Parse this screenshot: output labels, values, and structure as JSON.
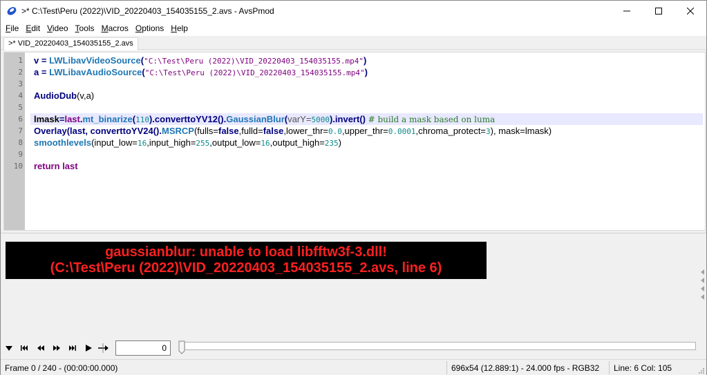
{
  "window": {
    "title": ">* C:\\Test\\Peru (2022)\\VID_20220403_154035155_2.avs - AvsPmod"
  },
  "menu": {
    "items": [
      {
        "label": "File",
        "mnemonic": "F",
        "rest": "ile"
      },
      {
        "label": "Edit",
        "mnemonic": "E",
        "rest": "dit"
      },
      {
        "label": "Video",
        "mnemonic": "V",
        "rest": "ideo"
      },
      {
        "label": "Tools",
        "mnemonic": "T",
        "rest": "ools"
      },
      {
        "label": "Macros",
        "mnemonic": "M",
        "rest": "acros"
      },
      {
        "label": "Options",
        "mnemonic": "O",
        "rest": "ptions"
      },
      {
        "label": "Help",
        "mnemonic": "H",
        "rest": "elp"
      }
    ]
  },
  "tabs": [
    {
      "label": ">* VID_20220403_154035155_2.avs"
    }
  ],
  "editor": {
    "line_numbers": [
      "1",
      "2",
      "3",
      "4",
      "5",
      "6",
      "7",
      "8",
      "9",
      "10"
    ],
    "lines": {
      "l1": {
        "a": "v",
        "b": " = ",
        "c": "LWLibavVideoSource",
        "d": "(",
        "e": "\"C:\\Test\\Peru (2022)\\VID_20220403_154035155.mp4\"",
        "f": ")"
      },
      "l2": {
        "a": "a",
        "b": " = ",
        "c": "LWLibavAudioSource",
        "d": "(",
        "e": "\"C:\\Test\\Peru (2022)\\VID_20220403_154035155.mp4\"",
        "f": ")"
      },
      "l4": {
        "a": "AudioDub",
        "b": "(v,a)"
      },
      "l6": {
        "a": "lmask",
        "b": "=",
        "c": "last",
        "d": ".",
        "e": "mt_binarize",
        "f": "(",
        "g": "110",
        "h": ").",
        "i": "converttoYV12",
        "j": "().",
        "k": "GaussianBlur",
        "l": "(",
        "m": "varY",
        "n": "=",
        "o": "5000",
        "p": ").",
        "q": "invert",
        "r": "() ",
        "s": "# build a mask based on luma"
      },
      "l7": {
        "a": "Overlay",
        "b": "(last, ",
        "c": "converttoYV24",
        "d": "().",
        "e": "MSRCP",
        "f": "(fulls=",
        "g": "false",
        "h": ",fulld=",
        "i": "false",
        "j": ",lower_thr=",
        "k": "0.0",
        "l": ",upper_thr=",
        "m": "0.0001",
        "n": ",chroma_protect=",
        "o": "3",
        "p": "), mask=lmask)"
      },
      "l8": {
        "a": "smoothlevels",
        "b": "(input_low=",
        "c": "16",
        "d": ",input_high=",
        "e": "255",
        "f": ",output_low=",
        "g": "16",
        "h": ",output_high=",
        "i": "235",
        "j": ")"
      },
      "l10": {
        "a": "return",
        "b": " ",
        "c": "last"
      }
    }
  },
  "preview": {
    "error_line1": "gaussianblur:  unable to load libfftw3f-3.dll!",
    "error_line2": "(C:\\Test\\Peru (2022)\\VID_20220403_154035155_2.avs, line 6)"
  },
  "playback": {
    "frame_value": "0"
  },
  "status": {
    "frame_info": "Frame 0 / 240   -  (00:00:00.000)",
    "video_info": "696x54 (12.889:1)  -  24.000 fps  -  RGB32",
    "cursor_info": "Line: 6  Col: 105"
  },
  "colors": {
    "error_text": "#ff2020",
    "current_line_bg": "#e8e8ff",
    "keyword": "#00007f",
    "function": "#1f77b4",
    "comment": "#2a7a2a"
  }
}
